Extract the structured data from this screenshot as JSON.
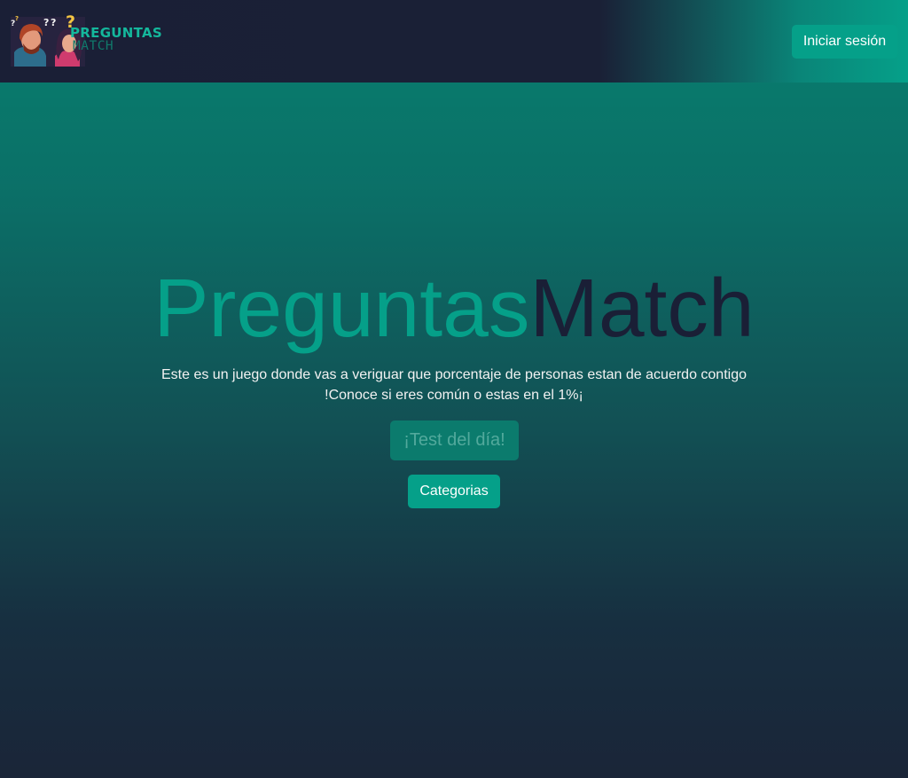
{
  "navbar": {
    "logo": {
      "text_top": "PREGUNTAS",
      "text_bottom": "MATCH",
      "icon": "couple-question-marks-logo"
    },
    "login_label": "Iniciar sesión"
  },
  "hero": {
    "title_part1": "Preguntas",
    "title_part2": "Match",
    "description_line1": "Este es un juego donde vas a veriguar que porcentaje de personas estan de acuerdo contigo",
    "description_line2": "!Conoce si eres común o estas en el 1%¡",
    "test_button_label": "¡Test del día!",
    "categories_button_label": "Categorias"
  },
  "colors": {
    "accent": "#05a089",
    "navy": "#1a1f36",
    "gradient_top": "#07806f",
    "gradient_bottom": "#1a2538"
  }
}
